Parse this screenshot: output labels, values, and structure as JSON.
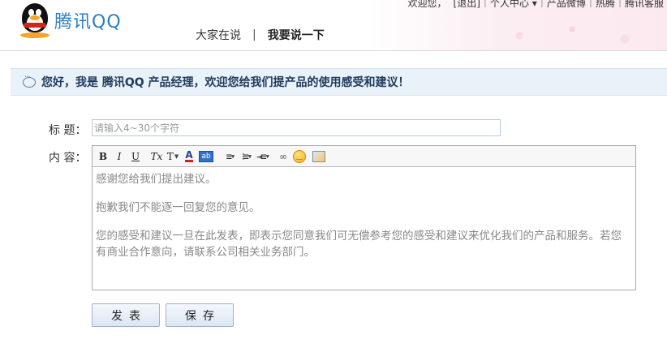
{
  "header": {
    "logo_text": "腾讯QQ",
    "top_links": [
      "欢迎您，",
      "[退出]",
      "个人中心 ▾",
      "产品微博",
      "热腾",
      "腾讯客服"
    ],
    "nav": {
      "item1": "大家在说",
      "separator": "|",
      "item2": "我要说一下"
    }
  },
  "notice": {
    "text": "您好，我是 腾讯QQ 产品经理，欢迎您给我们提产品的使用感受和建议！"
  },
  "form": {
    "title_label": "标 题：",
    "title_placeholder": "请输入4~30个字符",
    "content_label": "内 容：",
    "toolbar": {
      "bold": "B",
      "italic": "I",
      "underline": "U",
      "remove_format": "Tx",
      "font_size": "T",
      "font_color": "A",
      "highlight": "ab"
    },
    "content_paragraphs": [
      "感谢您给我们提出建议。",
      "抱歉我们不能逐一回复您的意见。",
      "您的感受和建议一旦在此发表，即表示您同意我们可无偿参考您的感受和建议来优化我们的产品和服务。若您有商业合作意向，请联系公司相关业务部门。"
    ]
  },
  "buttons": {
    "submit": "发表",
    "save": "保存"
  },
  "colors": {
    "accent": "#2a7fc4",
    "notice_bg": "#e9f1f9"
  }
}
